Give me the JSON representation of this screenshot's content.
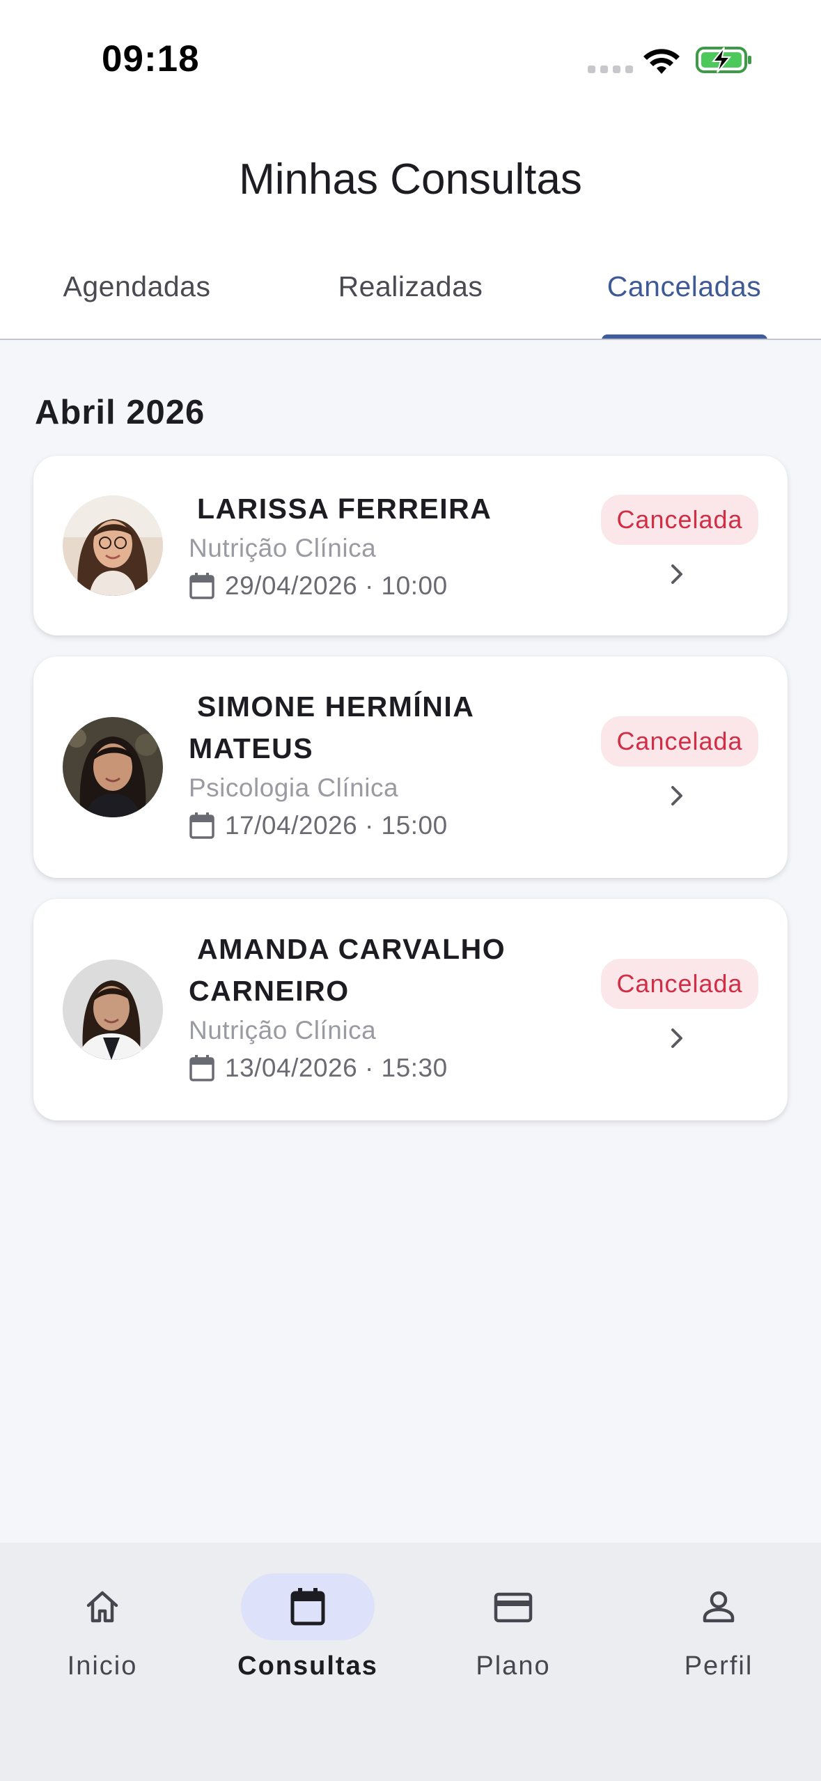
{
  "status_bar": {
    "time": "09:18",
    "icons": [
      "signal-icon",
      "wifi-icon",
      "battery-charging-icon"
    ]
  },
  "header": {
    "title": "Minhas Consultas"
  },
  "tabs": [
    {
      "label": "Agendadas",
      "selected": false
    },
    {
      "label": "Realizadas",
      "selected": false
    },
    {
      "label": "Canceladas",
      "selected": true
    }
  ],
  "section": {
    "month": "Abril 2026"
  },
  "appointments": [
    {
      "name_line1": "LARISSA FERREIRA",
      "name_line2": "",
      "specialty": "Nutrição Clínica",
      "datetime": "29/04/2026 · 10:00",
      "status": "Cancelada"
    },
    {
      "name_line1": "SIMONE HERMÍNIA",
      "name_line2": "MATEUS",
      "specialty": "Psicologia Clínica",
      "datetime": "17/04/2026 · 15:00",
      "status": "Cancelada"
    },
    {
      "name_line1": "AMANDA CARVALHO",
      "name_line2": "CARNEIRO",
      "specialty": "Nutrição Clínica",
      "datetime": "13/04/2026 · 15:30",
      "status": "Cancelada"
    }
  ],
  "bottom_nav": [
    {
      "label": "Inicio",
      "icon": "home-icon",
      "active": false
    },
    {
      "label": "Consultas",
      "icon": "calendar-icon",
      "active": true
    },
    {
      "label": "Plano",
      "icon": "credit-card-icon",
      "active": false
    },
    {
      "label": "Perfil",
      "icon": "person-icon",
      "active": false
    }
  ],
  "colors": {
    "accent": "#415c99",
    "status_cancelled_text": "#d12d45",
    "status_cancelled_bg": "#fbe6e9",
    "background": "#f5f6fa",
    "nav_active_bg": "#dde2fa"
  }
}
